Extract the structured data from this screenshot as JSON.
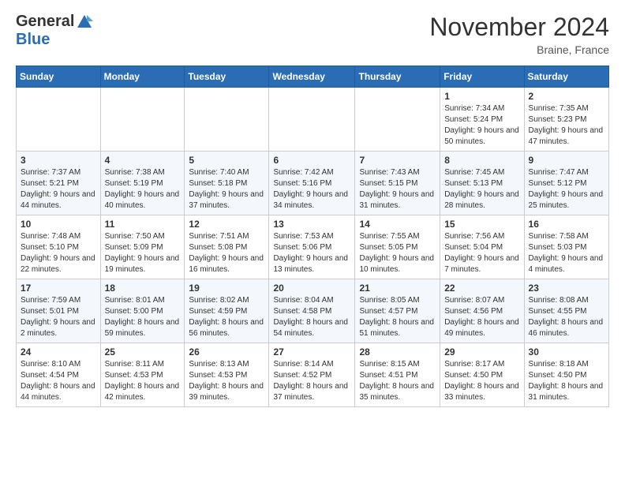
{
  "header": {
    "logo_general": "General",
    "logo_blue": "Blue",
    "month_title": "November 2024",
    "location": "Braine, France"
  },
  "days_of_week": [
    "Sunday",
    "Monday",
    "Tuesday",
    "Wednesday",
    "Thursday",
    "Friday",
    "Saturday"
  ],
  "weeks": [
    [
      {
        "day": "",
        "info": ""
      },
      {
        "day": "",
        "info": ""
      },
      {
        "day": "",
        "info": ""
      },
      {
        "day": "",
        "info": ""
      },
      {
        "day": "",
        "info": ""
      },
      {
        "day": "1",
        "info": "Sunrise: 7:34 AM\nSunset: 5:24 PM\nDaylight: 9 hours and 50 minutes."
      },
      {
        "day": "2",
        "info": "Sunrise: 7:35 AM\nSunset: 5:23 PM\nDaylight: 9 hours and 47 minutes."
      }
    ],
    [
      {
        "day": "3",
        "info": "Sunrise: 7:37 AM\nSunset: 5:21 PM\nDaylight: 9 hours and 44 minutes."
      },
      {
        "day": "4",
        "info": "Sunrise: 7:38 AM\nSunset: 5:19 PM\nDaylight: 9 hours and 40 minutes."
      },
      {
        "day": "5",
        "info": "Sunrise: 7:40 AM\nSunset: 5:18 PM\nDaylight: 9 hours and 37 minutes."
      },
      {
        "day": "6",
        "info": "Sunrise: 7:42 AM\nSunset: 5:16 PM\nDaylight: 9 hours and 34 minutes."
      },
      {
        "day": "7",
        "info": "Sunrise: 7:43 AM\nSunset: 5:15 PM\nDaylight: 9 hours and 31 minutes."
      },
      {
        "day": "8",
        "info": "Sunrise: 7:45 AM\nSunset: 5:13 PM\nDaylight: 9 hours and 28 minutes."
      },
      {
        "day": "9",
        "info": "Sunrise: 7:47 AM\nSunset: 5:12 PM\nDaylight: 9 hours and 25 minutes."
      }
    ],
    [
      {
        "day": "10",
        "info": "Sunrise: 7:48 AM\nSunset: 5:10 PM\nDaylight: 9 hours and 22 minutes."
      },
      {
        "day": "11",
        "info": "Sunrise: 7:50 AM\nSunset: 5:09 PM\nDaylight: 9 hours and 19 minutes."
      },
      {
        "day": "12",
        "info": "Sunrise: 7:51 AM\nSunset: 5:08 PM\nDaylight: 9 hours and 16 minutes."
      },
      {
        "day": "13",
        "info": "Sunrise: 7:53 AM\nSunset: 5:06 PM\nDaylight: 9 hours and 13 minutes."
      },
      {
        "day": "14",
        "info": "Sunrise: 7:55 AM\nSunset: 5:05 PM\nDaylight: 9 hours and 10 minutes."
      },
      {
        "day": "15",
        "info": "Sunrise: 7:56 AM\nSunset: 5:04 PM\nDaylight: 9 hours and 7 minutes."
      },
      {
        "day": "16",
        "info": "Sunrise: 7:58 AM\nSunset: 5:03 PM\nDaylight: 9 hours and 4 minutes."
      }
    ],
    [
      {
        "day": "17",
        "info": "Sunrise: 7:59 AM\nSunset: 5:01 PM\nDaylight: 9 hours and 2 minutes."
      },
      {
        "day": "18",
        "info": "Sunrise: 8:01 AM\nSunset: 5:00 PM\nDaylight: 8 hours and 59 minutes."
      },
      {
        "day": "19",
        "info": "Sunrise: 8:02 AM\nSunset: 4:59 PM\nDaylight: 8 hours and 56 minutes."
      },
      {
        "day": "20",
        "info": "Sunrise: 8:04 AM\nSunset: 4:58 PM\nDaylight: 8 hours and 54 minutes."
      },
      {
        "day": "21",
        "info": "Sunrise: 8:05 AM\nSunset: 4:57 PM\nDaylight: 8 hours and 51 minutes."
      },
      {
        "day": "22",
        "info": "Sunrise: 8:07 AM\nSunset: 4:56 PM\nDaylight: 8 hours and 49 minutes."
      },
      {
        "day": "23",
        "info": "Sunrise: 8:08 AM\nSunset: 4:55 PM\nDaylight: 8 hours and 46 minutes."
      }
    ],
    [
      {
        "day": "24",
        "info": "Sunrise: 8:10 AM\nSunset: 4:54 PM\nDaylight: 8 hours and 44 minutes."
      },
      {
        "day": "25",
        "info": "Sunrise: 8:11 AM\nSunset: 4:53 PM\nDaylight: 8 hours and 42 minutes."
      },
      {
        "day": "26",
        "info": "Sunrise: 8:13 AM\nSunset: 4:53 PM\nDaylight: 8 hours and 39 minutes."
      },
      {
        "day": "27",
        "info": "Sunrise: 8:14 AM\nSunset: 4:52 PM\nDaylight: 8 hours and 37 minutes."
      },
      {
        "day": "28",
        "info": "Sunrise: 8:15 AM\nSunset: 4:51 PM\nDaylight: 8 hours and 35 minutes."
      },
      {
        "day": "29",
        "info": "Sunrise: 8:17 AM\nSunset: 4:50 PM\nDaylight: 8 hours and 33 minutes."
      },
      {
        "day": "30",
        "info": "Sunrise: 8:18 AM\nSunset: 4:50 PM\nDaylight: 8 hours and 31 minutes."
      }
    ]
  ]
}
